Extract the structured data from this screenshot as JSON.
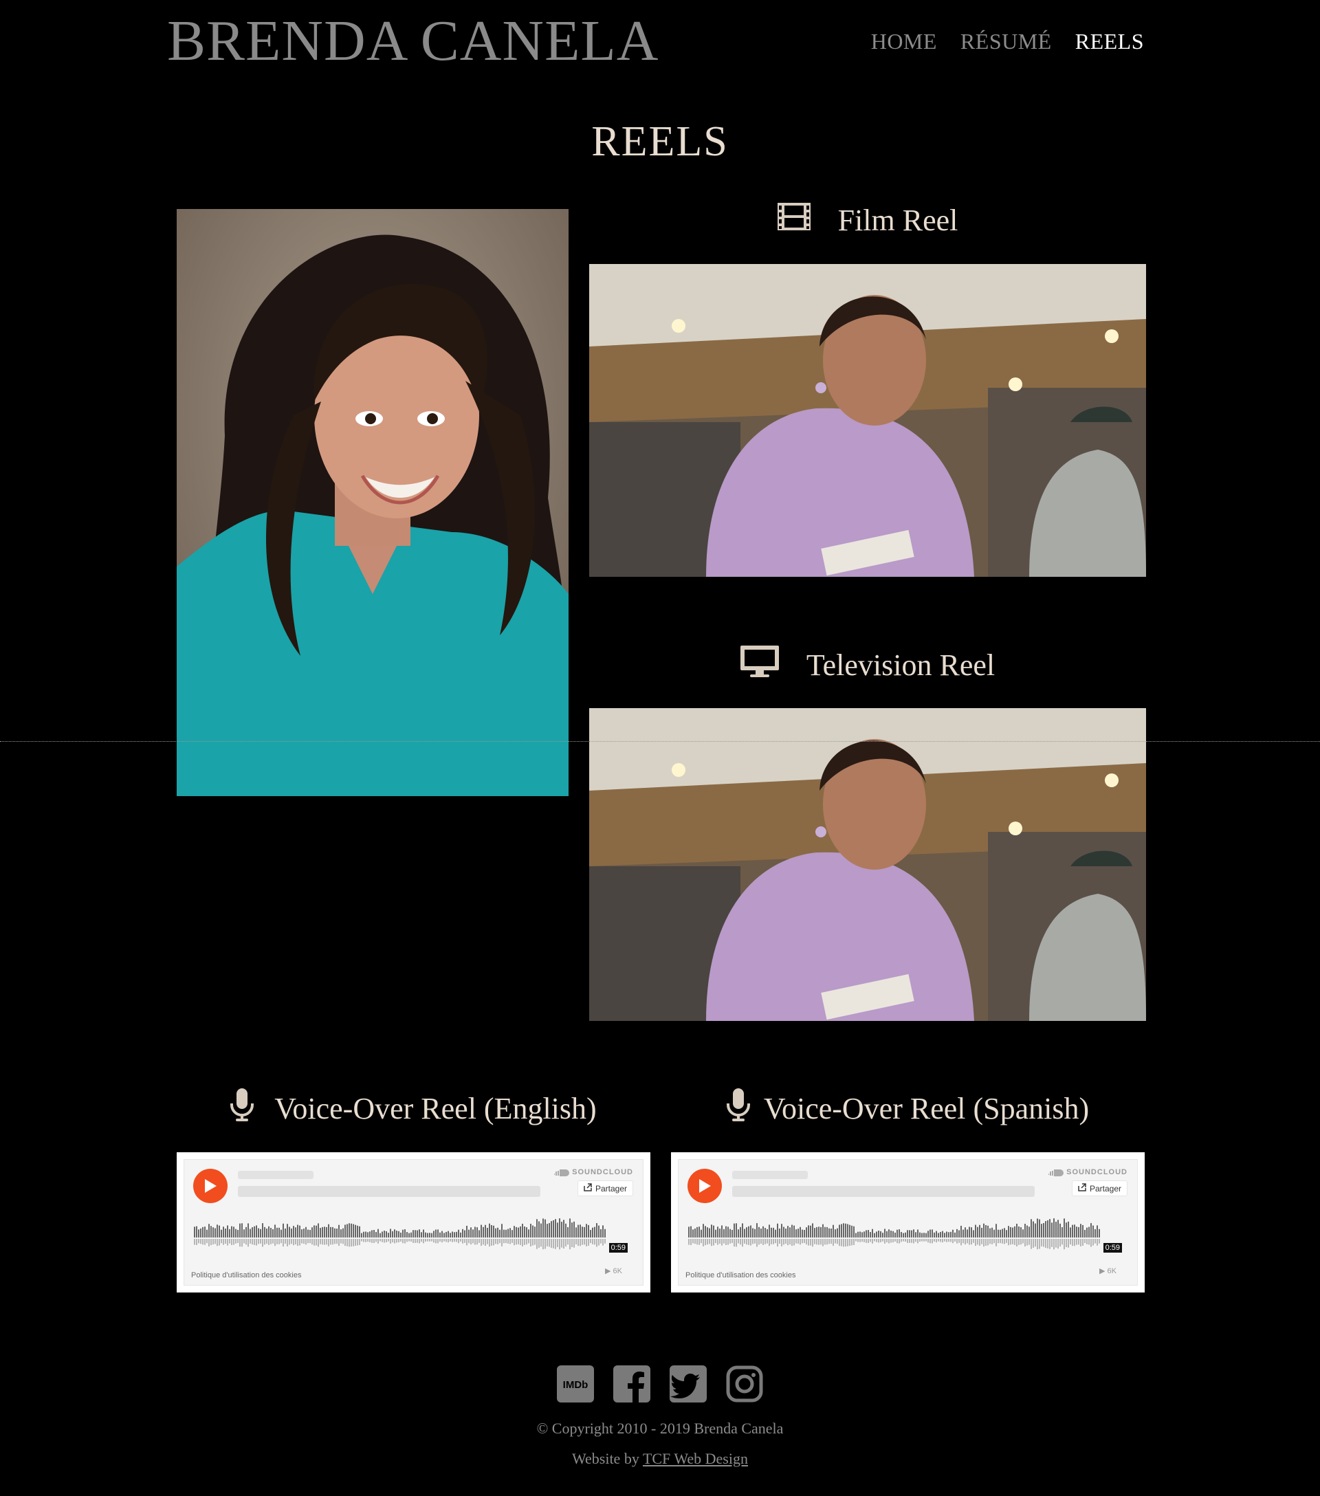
{
  "site": {
    "title": "BRENDA CANELA"
  },
  "nav": {
    "items": [
      {
        "label": "HOME"
      },
      {
        "label": "RÉSUMÉ"
      },
      {
        "label": "REELS"
      }
    ]
  },
  "page": {
    "title": "REELS"
  },
  "film_reel": {
    "heading": "Film Reel",
    "icon": "film-icon"
  },
  "tv_reel": {
    "heading": "Television Reel",
    "icon": "monitor-icon"
  },
  "vo_english": {
    "heading": "Voice-Over Reel (English)",
    "icon": "microphone-icon",
    "widget": {
      "brand": "SOUNDCLOUD",
      "share_label": "Partager",
      "duration": "0:59",
      "cookie_policy": "Politique d'utilisation des cookies",
      "plays": "6K"
    }
  },
  "vo_spanish": {
    "heading": "Voice-Over Reel (Spanish)",
    "icon": "microphone-icon",
    "widget": {
      "brand": "SOUNDCLOUD",
      "share_label": "Partager",
      "duration": "0:59",
      "cookie_policy": "Politique d'utilisation des cookies",
      "plays": "6K"
    }
  },
  "social": [
    "imdb-icon",
    "facebook-icon",
    "twitter-icon",
    "instagram-icon"
  ],
  "footer": {
    "copyright": "© Copyright 2010 - 2019 Brenda Canela",
    "credit_prefix": "Website by",
    "credit_link": "TCF Web Design"
  },
  "colors": {
    "background": "#000000",
    "heading": "#e8ddd0",
    "nav_inactive": "#8c8c8c",
    "nav_active": "#ffffff",
    "soundcloud_orange": "#f24d1e"
  }
}
